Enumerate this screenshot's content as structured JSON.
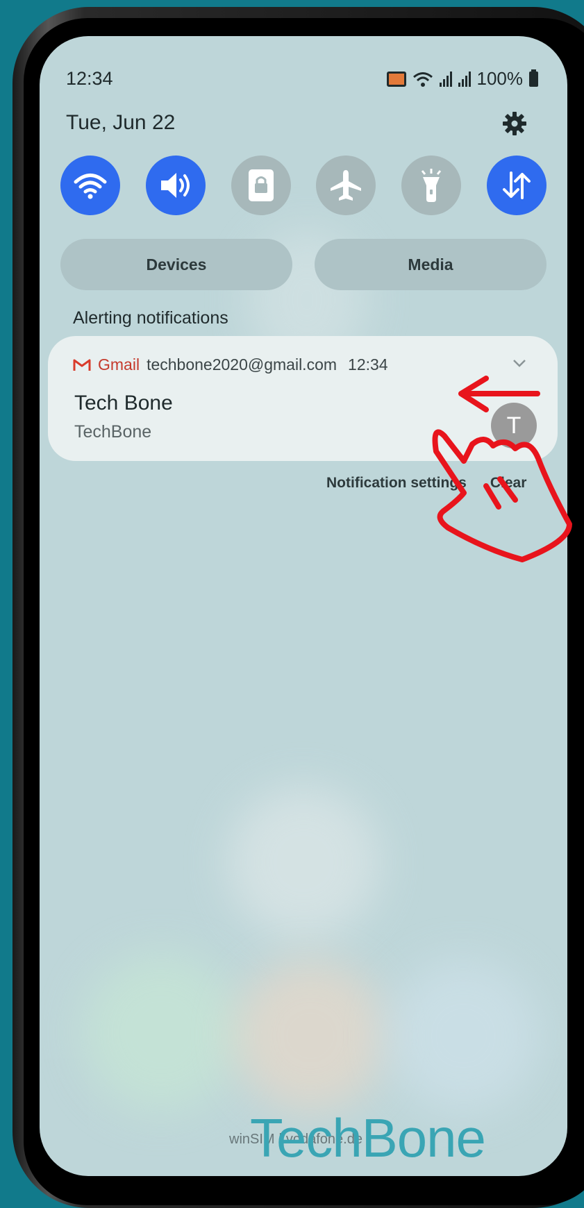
{
  "status_bar": {
    "time": "12:34",
    "battery": "100%"
  },
  "header": {
    "date": "Tue, Jun 22"
  },
  "quick_settings": [
    {
      "name": "wifi",
      "state": "on"
    },
    {
      "name": "sound",
      "state": "on"
    },
    {
      "name": "screen-lock",
      "state": "off"
    },
    {
      "name": "airplane-mode",
      "state": "off"
    },
    {
      "name": "flashlight",
      "state": "off"
    },
    {
      "name": "mobile-data",
      "state": "on"
    }
  ],
  "panels": {
    "devices_label": "Devices",
    "media_label": "Media"
  },
  "notifications": {
    "section_label": "Alerting notifications",
    "items": [
      {
        "app": "Gmail",
        "account": "techbone2020@gmail.com",
        "time": "12:34",
        "title": "Tech Bone",
        "subtitle": "TechBone",
        "avatar_letter": "T"
      }
    ],
    "settings_label": "Notification settings",
    "clear_label": "Clear"
  },
  "footer": {
    "carrier": "winSIM | vodafone.de"
  },
  "watermark": "TechBone",
  "colors": {
    "accent": "#2f6bef",
    "gmail_red": "#c53a2c",
    "annotation": "#e8141c",
    "background": "#117a8b"
  }
}
